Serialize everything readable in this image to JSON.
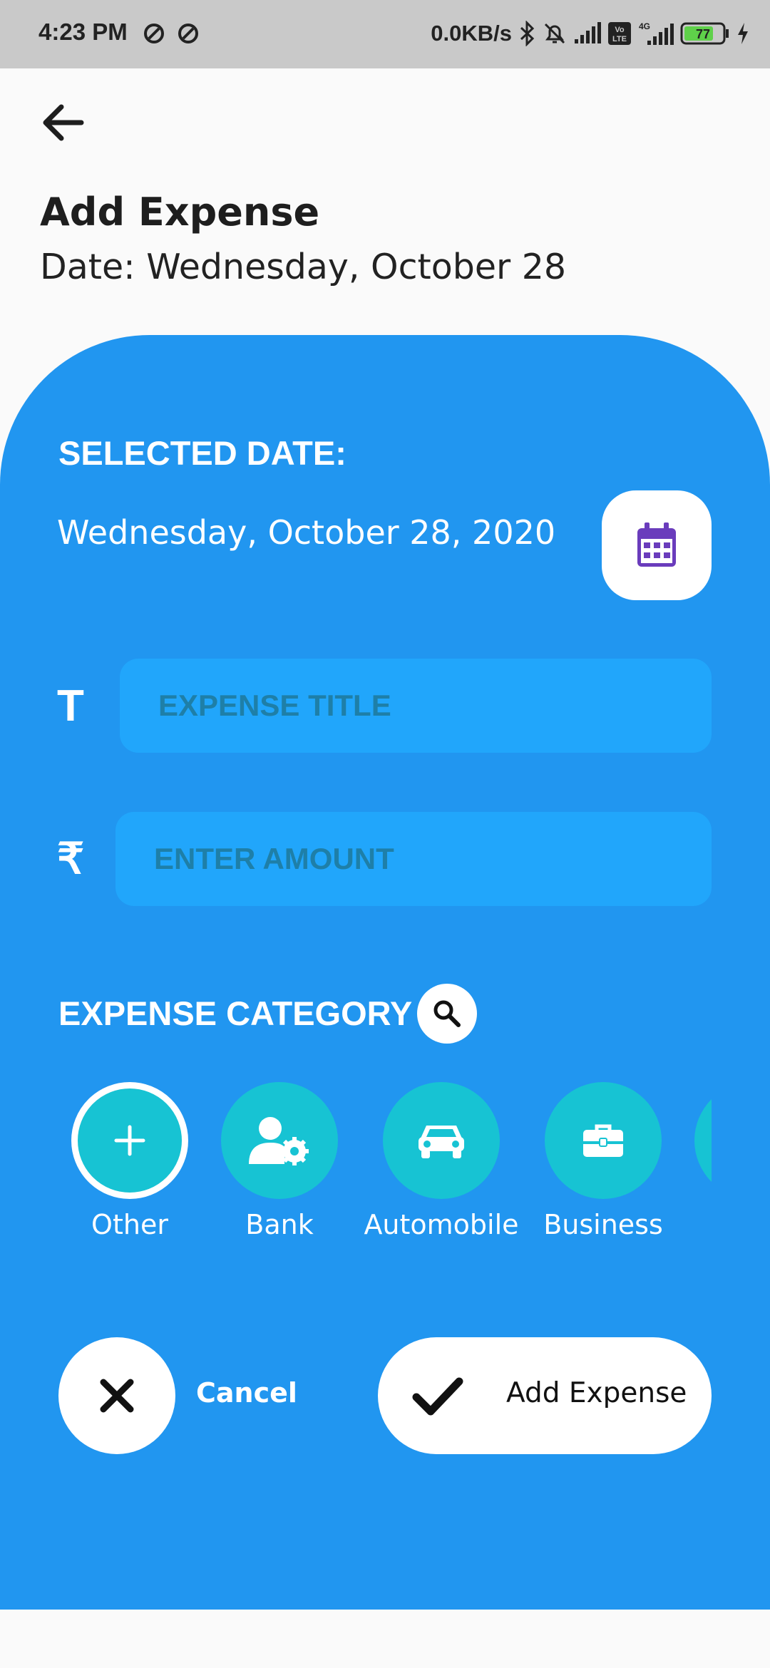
{
  "status_bar": {
    "time": "4:23 PM",
    "network_speed": "0.0KB/s",
    "battery": "77",
    "icons": [
      "app-notification-icon",
      "app-notification-icon",
      "bluetooth-icon",
      "mute-bell-icon",
      "signal-icon",
      "volte-icon",
      "4g-signal-icon",
      "battery-icon",
      "charging-icon"
    ]
  },
  "header": {
    "back_icon": "back-arrow-icon",
    "title": "Add Expense",
    "date": "Date: Wednesday, October 28"
  },
  "form": {
    "selected_date_label": "SELECTED DATE:",
    "selected_date_value": "Wednesday, October 28, 2020",
    "calendar_icon": "calendar-icon",
    "title_glyph": "T",
    "title_placeholder": "EXPENSE TITLE",
    "amount_glyph": "₹",
    "amount_placeholder": "ENTER AMOUNT",
    "category_label": "EXPENSE CATEGORY",
    "category_search_icon": "search-icon",
    "categories": [
      {
        "label": "Other",
        "icon": "plus-icon",
        "selected": true
      },
      {
        "label": "Bank",
        "icon": "user-gear-icon",
        "selected": false
      },
      {
        "label": "Automobile",
        "icon": "car-icon",
        "selected": false
      },
      {
        "label": "Business",
        "icon": "briefcase-icon",
        "selected": false
      }
    ]
  },
  "actions": {
    "cancel_label": "Cancel",
    "cancel_icon": "close-icon",
    "add_label": "Add Expense",
    "add_icon": "check-icon"
  },
  "colors": {
    "panel": "#2196f0",
    "field": "#21a6fb",
    "category": "#17c3d3",
    "calendar_accent": "#6a3cbc",
    "status_bar": "#c9c9c9"
  }
}
